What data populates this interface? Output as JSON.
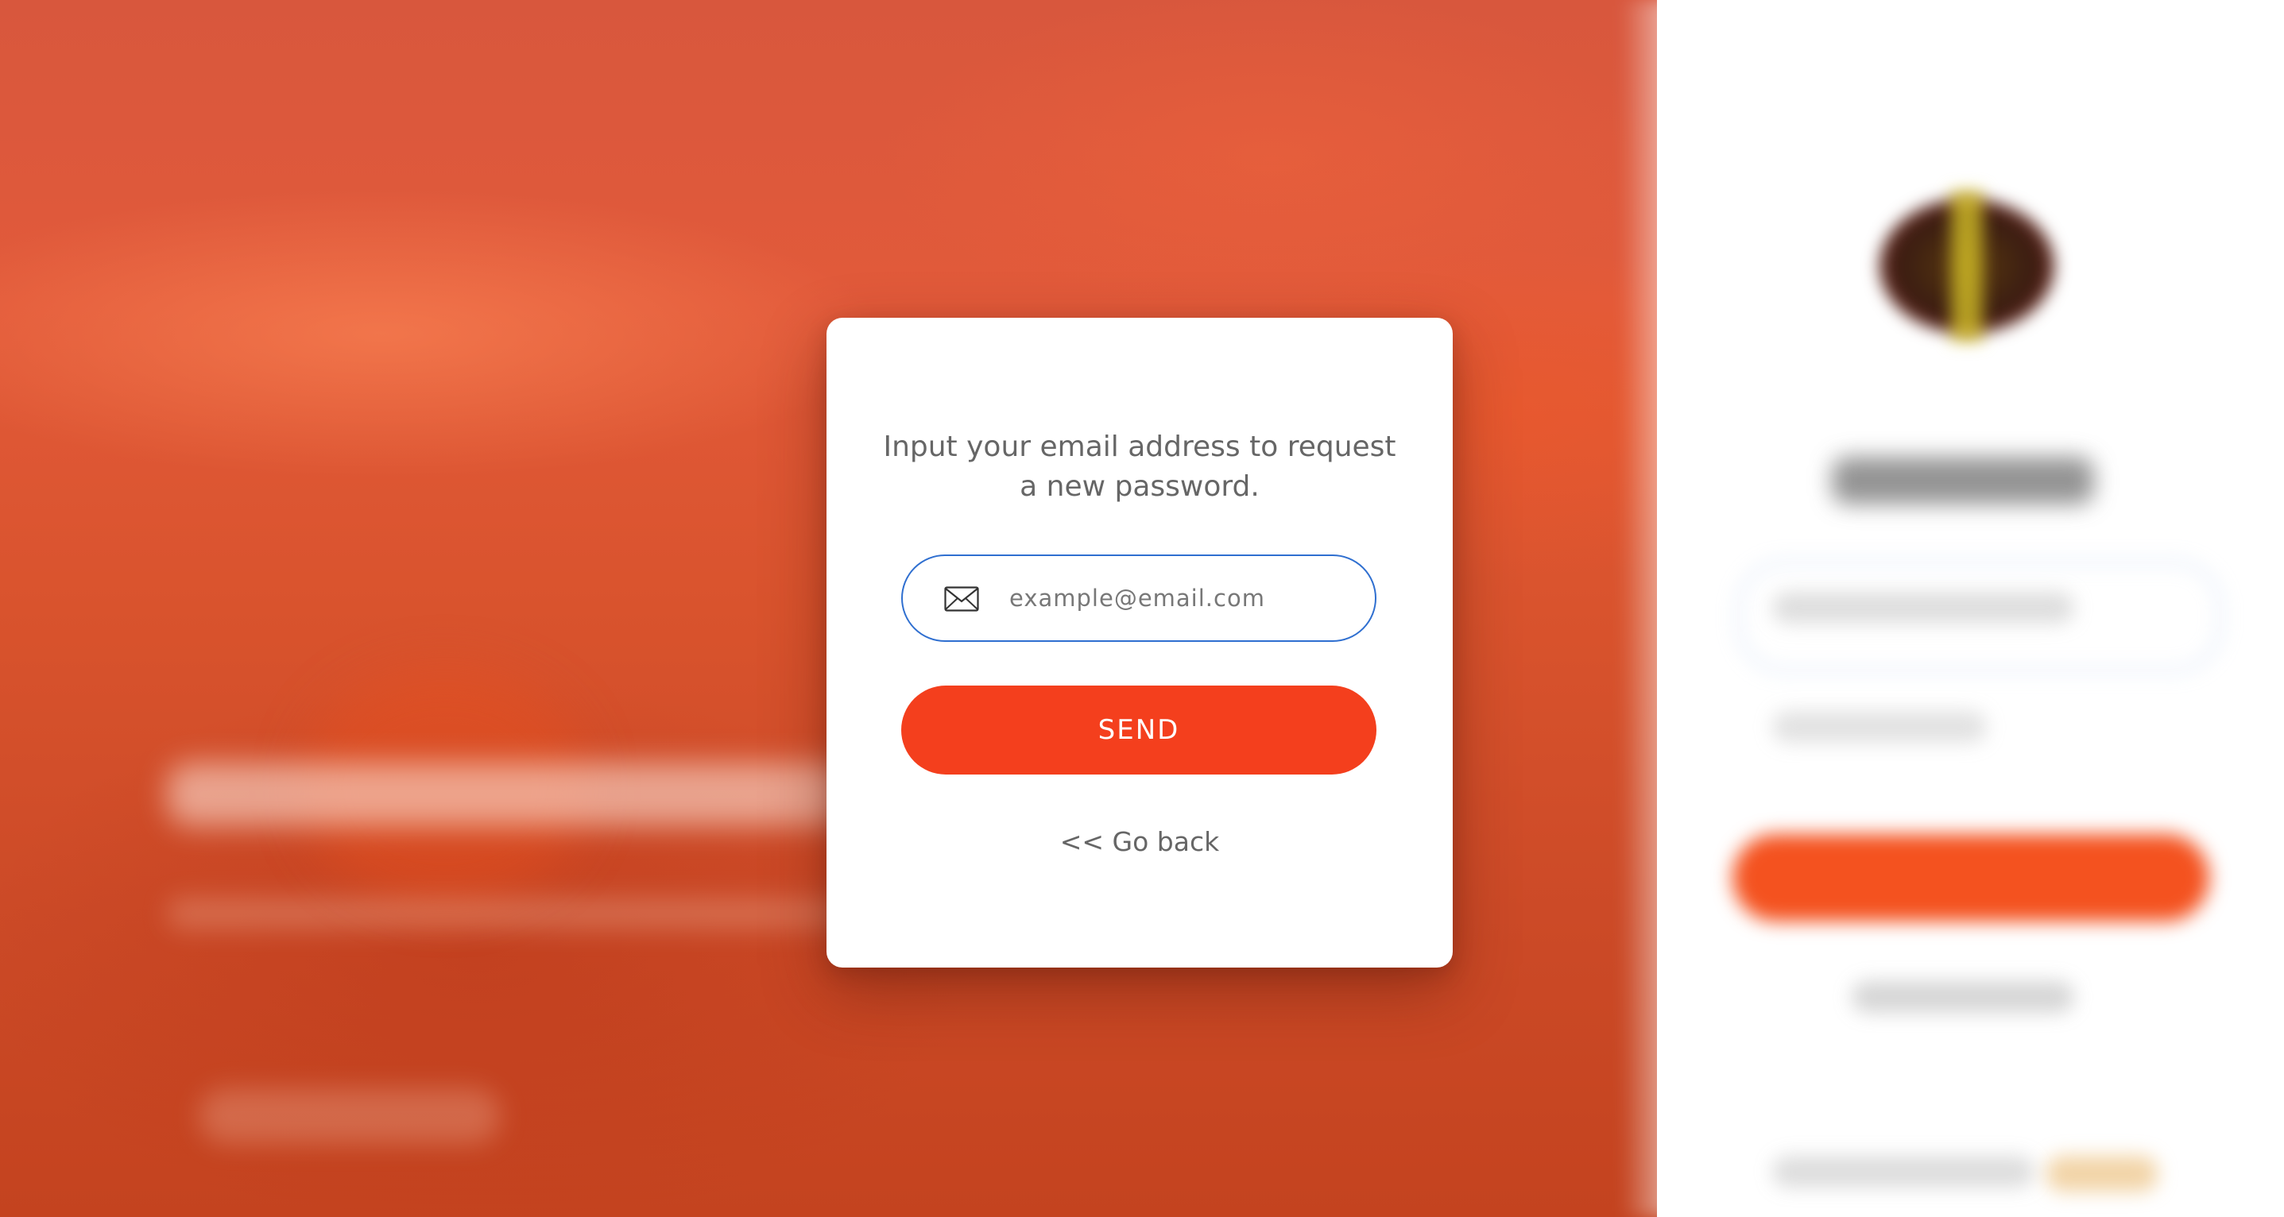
{
  "modal": {
    "message": "Input your email address to request a new password.",
    "email_placeholder": "example@email.com",
    "email_value": "",
    "send_label": "SEND",
    "back_label": "<< Go back",
    "icons": {
      "email": "mail-icon"
    }
  },
  "colors": {
    "accent": "#f43f1d",
    "input_border": "#2f6fd0",
    "text": "#666666",
    "background": "#d9532d"
  }
}
